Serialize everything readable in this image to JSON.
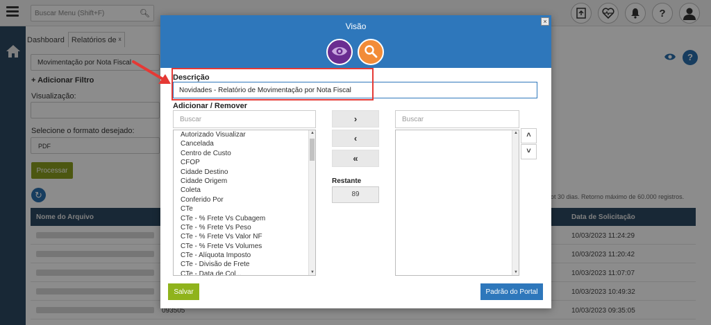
{
  "topbar": {
    "search_placeholder": "Buscar Menu  (Shift+F)",
    "icons": [
      "upload-icon",
      "heart-pulse-icon",
      "bell-icon",
      "help-icon",
      "user-icon"
    ],
    "help_glyph": "?"
  },
  "tabs": [
    {
      "label": "Dashboard"
    },
    {
      "label": "Relatórios de",
      "close": "x"
    }
  ],
  "background": {
    "report_value": "Movimentação por Nota Fiscal",
    "add_filter": "+ Adicionar Filtro",
    "visualizacao_label": "Visualização:",
    "formato_label": "Selecione o formato desejado:",
    "formato_value": "PDF",
    "processar": "Processar",
    "info": "ot 30 dias. Retorno máximo de 60.000 registros.",
    "grid": {
      "col_nome": "Nome do Arquivo",
      "col_data": "Data de Solicitação",
      "rows": [
        {
          "id": "",
          "date": "10/03/2023 11:24:29"
        },
        {
          "id": "",
          "date": "10/03/2023 11:20:42"
        },
        {
          "id": "",
          "date": "10/03/2023 11:07:07"
        },
        {
          "id": "",
          "date": "10/03/2023 10:49:32"
        },
        {
          "id": "093505",
          "date": "10/03/2023 09:35:05"
        }
      ]
    }
  },
  "modal": {
    "title": "Visão",
    "close": "×",
    "descricao_label": "Descrição",
    "descricao_value": "Novidades - Relatório de Movimentação por Nota Fiscal",
    "adicionar_label": "Adicionar / Remover",
    "search_left_placeholder": "Buscar",
    "search_right_placeholder": "Buscar",
    "available_items": [
      "Autorizado Visualizar",
      "Cancelada",
      "Centro de Custo",
      "CFOP",
      "Cidade Destino",
      "Cidade Origem",
      "Coleta",
      "Conferido Por",
      "CTe",
      "CTe - % Frete Vs Cubagem",
      "CTe - % Frete Vs Peso",
      "CTe - % Frete Vs Valor NF",
      "CTe - % Frete Vs Volumes",
      "CTe - Alíquota Imposto",
      "CTe - Divisão de Frete",
      "CTe - Data de Col..."
    ],
    "move_right": "›",
    "move_left": "‹",
    "move_all_left": "«",
    "restante_label": "Restante",
    "restante_value": "89",
    "order_up": "˄",
    "order_down": "˅",
    "salvar": "Salvar",
    "padrao": "Padrão do Portal"
  },
  "colors": {
    "header_blue": "#2e77bb",
    "sidebar": "#2d4a63",
    "eye_purple": "#6a2d91",
    "search_orange": "#f28c38",
    "save_green": "#8fb31c",
    "highlight_red": "#e53935"
  }
}
